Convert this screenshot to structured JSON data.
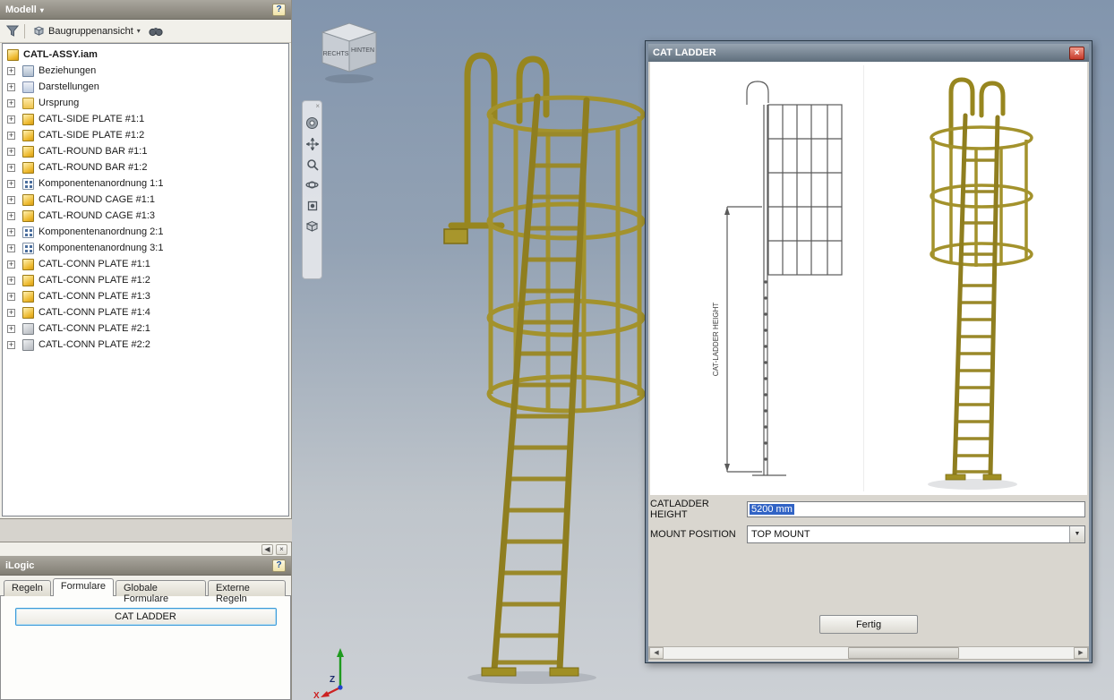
{
  "icons": {
    "dropdown_arrow": "▾",
    "help": "?",
    "close": "×",
    "panel_collapse": "◀",
    "scroll_left": "◀",
    "scroll_right": "▶",
    "combo_arrow": "▼",
    "nav_close": "×"
  },
  "colors": {
    "ladder_gold": "#9a8922",
    "selection_blue": "#3163c5"
  },
  "browser": {
    "title": "Modell",
    "toolbar": {
      "view_selector": "Baugruppenansicht"
    },
    "tree": [
      {
        "label": "CATL-ASSY.iam",
        "icon": "assembly",
        "bold": true,
        "expander": ""
      },
      {
        "label": "Beziehungen",
        "icon": "relationships",
        "expander": "+"
      },
      {
        "label": "Darstellungen",
        "icon": "representations",
        "expander": "+"
      },
      {
        "label": "Ursprung",
        "icon": "origin",
        "expander": "+"
      },
      {
        "label": "CATL-SIDE PLATE #1:1",
        "icon": "part",
        "expander": "+"
      },
      {
        "label": "CATL-SIDE PLATE #1:2",
        "icon": "part",
        "expander": "+"
      },
      {
        "label": "CATL-ROUND BAR #1:1",
        "icon": "part",
        "expander": "+"
      },
      {
        "label": "CATL-ROUND BAR #1:2",
        "icon": "part",
        "expander": "+"
      },
      {
        "label": "Komponentenanordnung 1:1",
        "icon": "pattern",
        "expander": "+"
      },
      {
        "label": "CATL-ROUND CAGE #1:1",
        "icon": "part",
        "expander": "+"
      },
      {
        "label": "CATL-ROUND CAGE #1:3",
        "icon": "part",
        "expander": "+"
      },
      {
        "label": "Komponentenanordnung 2:1",
        "icon": "pattern",
        "expander": "+"
      },
      {
        "label": "Komponentenanordnung 3:1",
        "icon": "pattern",
        "expander": "+"
      },
      {
        "label": "CATL-CONN PLATE #1:1",
        "icon": "part",
        "expander": "+"
      },
      {
        "label": "CATL-CONN PLATE #1:2",
        "icon": "part",
        "expander": "+"
      },
      {
        "label": "CATL-CONN PLATE #1:3",
        "icon": "part",
        "expander": "+"
      },
      {
        "label": "CATL-CONN PLATE #1:4",
        "icon": "part",
        "expander": "+"
      },
      {
        "label": "CATL-CONN PLATE #2:1",
        "icon": "part-gray",
        "expander": "+"
      },
      {
        "label": "CATL-CONN PLATE #2:2",
        "icon": "part-gray",
        "expander": "+"
      }
    ]
  },
  "ilogic": {
    "title": "iLogic",
    "tabs": [
      {
        "label": "Regeln",
        "active": false
      },
      {
        "label": "Formulare",
        "active": true
      },
      {
        "label": "Globale Formulare",
        "active": false
      },
      {
        "label": "Externe Regeln",
        "active": false
      }
    ],
    "form_button_label": "CAT LADDER"
  },
  "viewport": {
    "viewcube": {
      "left_face": "RECHTS",
      "right_face": "HINTEN"
    },
    "triad": {
      "up_label": "Z",
      "left_label": "X"
    }
  },
  "dialog": {
    "title": "CAT LADDER",
    "drawing": {
      "dimension_label": "CAT-LADDER HEIGHT"
    },
    "fields": {
      "height_label": "CATLADDER HEIGHT",
      "height_value": "5200 mm",
      "mount_label": "MOUNT POSITION",
      "mount_value": "TOP MOUNT"
    },
    "done_label": "Fertig"
  }
}
